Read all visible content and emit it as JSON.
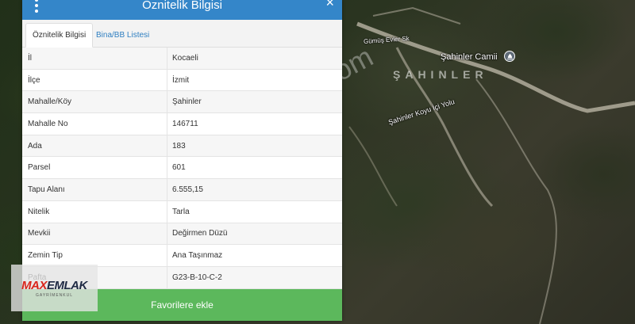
{
  "panel": {
    "title": "Öznitelik Bilgisi",
    "close_label": "×",
    "tabs": [
      {
        "label": "Öznitelik Bilgisi",
        "active": true
      },
      {
        "label": "Bina/BB Listesi",
        "active": false
      }
    ],
    "rows": [
      {
        "key": "İl",
        "value": "Kocaeli"
      },
      {
        "key": "İlçe",
        "value": "İzmit"
      },
      {
        "key": "Mahalle/Köy",
        "value": "Şahinler"
      },
      {
        "key": "Mahalle No",
        "value": "146711"
      },
      {
        "key": "Ada",
        "value": "183"
      },
      {
        "key": "Parsel",
        "value": "601"
      },
      {
        "key": "Tapu Alanı",
        "value": "6.555,15"
      },
      {
        "key": "Nitelik",
        "value": "Tarla"
      },
      {
        "key": "Mevkii",
        "value": "Değirmen Düzü"
      },
      {
        "key": "Zemin Tip",
        "value": "Ana Taşınmaz"
      },
      {
        "key": "Pafta",
        "value": "G23-B-10-C-2"
      }
    ],
    "favorite_button": "Favorilere ekle"
  },
  "map": {
    "labels": {
      "mosque": "Şahinler Camii",
      "village": "ŞAHINLER",
      "road": "Şahinler Koyu İçi Yolu",
      "street_small": "Gümüş Evler Sk"
    },
    "watermark": "emlakjet.com"
  },
  "logo": {
    "part_a": "MAX",
    "part_b": "EMLAK",
    "sub": "GAYRİMENKUL"
  },
  "colors": {
    "header": "#3486c9",
    "button": "#5cb85c",
    "tab_link": "#2f7fc1"
  }
}
